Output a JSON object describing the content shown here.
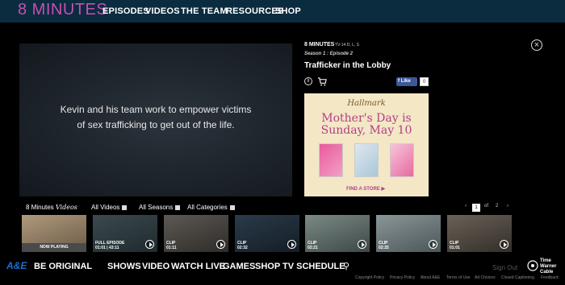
{
  "header": {
    "logo": "8 MINUTES",
    "nav": [
      "EPISODES",
      "VIDEOS",
      "THE TEAM",
      "RESOURCES",
      "SHOP"
    ]
  },
  "player": {
    "caption": "Kevin and his team work to empower victims of sex trafficking to get out of the life."
  },
  "episode": {
    "show": "8 MINUTES",
    "rating": "TV-14 D, L, S",
    "season": "Season 1 : Episode 2",
    "title": "Trafficker in the Lobby",
    "info_glyph": "i",
    "like_label": "Like",
    "like_count": "0"
  },
  "ad": {
    "brand": "Hallmark",
    "headline_line1": "Mother's Day is",
    "headline_line2": "Sunday, May 10",
    "cta": "FIND A STORE ▶"
  },
  "close_glyph": "×",
  "filters": {
    "title": "8 Minutes",
    "title_italic": "Videos",
    "all_videos": "All Videos",
    "all_seasons": "All Seasons",
    "all_categories": "All Categories"
  },
  "pagination": {
    "prev": "‹",
    "current": "1",
    "of": "of",
    "total": "2",
    "next": "›"
  },
  "thumbnails": [
    {
      "label": "NOW PLAYING",
      "now_playing": true
    },
    {
      "label_line1": "FULL EPISODE",
      "label_line2": "01:01 | 43:11"
    },
    {
      "label_line1": "CLIP",
      "label_line2": "01:11"
    },
    {
      "label_line1": "CLIP",
      "label_line2": "02:32"
    },
    {
      "label_line1": "CLIP",
      "label_line2": "02:21"
    },
    {
      "label_line1": "CLIP",
      "label_line2": "02:25"
    },
    {
      "label_line1": "CLIP",
      "label_line2": "01:01"
    }
  ],
  "footer": {
    "brand": "A&E",
    "tagline": "BE ORIGINAL",
    "nav": [
      "SHOWS",
      "VIDEO",
      "WATCH LIVE",
      "GAMES",
      "SHOP",
      "TV SCHEDULE"
    ],
    "search_glyph": "⚲",
    "sign_out": "Sign Out",
    "provider_line1": "Time",
    "provider_line2": "Warner",
    "provider_line3": "Cable",
    "links": [
      "Copyright Policy",
      "Privacy Policy",
      "About A&E",
      "Terms of Use",
      "Ad Choices",
      "Closed Captioning",
      "Feedback"
    ]
  },
  "colors": {
    "brand_pink": "#c74fb0",
    "nav_bg": "#0b2b3f",
    "ae_blue": "#1f6fd1",
    "fb_blue": "#3b5998",
    "ad_bg": "#f3e7c6"
  }
}
